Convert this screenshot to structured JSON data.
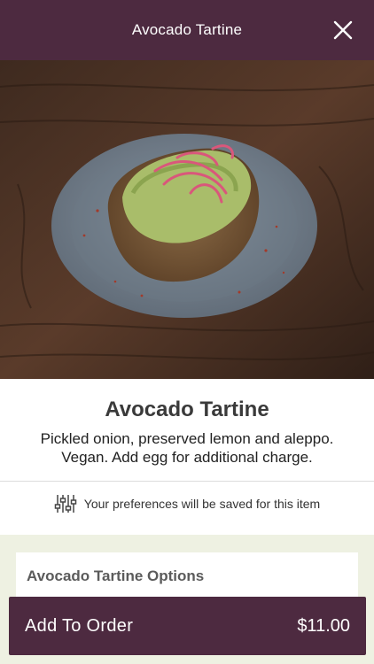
{
  "header": {
    "title": "Avocado Tartine",
    "close_icon": "close-icon"
  },
  "item": {
    "image_icon": "avocado-tartine-photo",
    "title": "Avocado Tartine",
    "description": "Pickled onion, preserved lemon and aleppo. Vegan. Add egg for additional charge."
  },
  "preferences": {
    "icon": "sliders-icon",
    "text": "Your preferences will be saved for this item"
  },
  "options": {
    "title": "Avocado Tartine Options"
  },
  "order": {
    "label": "Add To Order",
    "price": "$11.00"
  },
  "colors": {
    "brand": "#4d2a40",
    "options_bg": "#eef1e2"
  }
}
